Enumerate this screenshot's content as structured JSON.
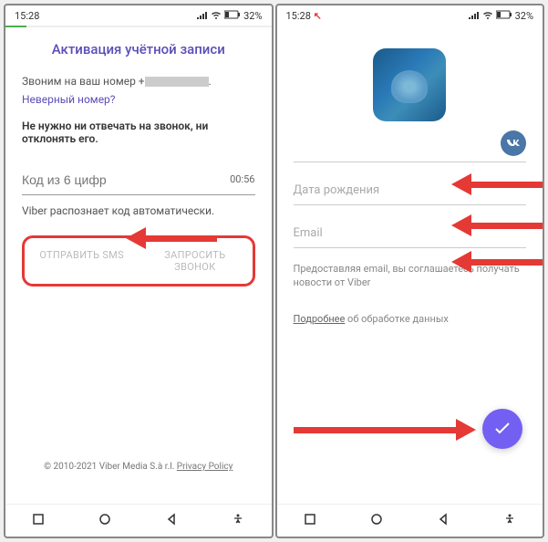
{
  "statusbar": {
    "time": "15:28",
    "battery": "32%"
  },
  "screen1": {
    "title": "Активация учётной записи",
    "calling_prefix": "Звоним на ваш номер +",
    "wrong_number": "Неверный номер?",
    "instruction": "Не нужно ни отвечать на звонок, ни отклонять его.",
    "code_placeholder": "Код из 6 цифр",
    "timer": "00:56",
    "auto_detect": "Viber распознает код автоматически.",
    "sms_button": "ОТПРАВИТЬ SMS",
    "call_button": "ЗАПРОСИТЬ ЗВОНОК",
    "copyright": "© 2010-2021 Viber Media S.à r.l.",
    "privacy": "Privacy Policy"
  },
  "screen2": {
    "vk_label": "VK",
    "birthday_placeholder": "Дата рождения",
    "email_placeholder": "Email",
    "consent": "Предоставляя email, вы соглашаетесь получать новости от Viber",
    "more_link": "Подробнее",
    "more_rest": " об обработке данных"
  }
}
